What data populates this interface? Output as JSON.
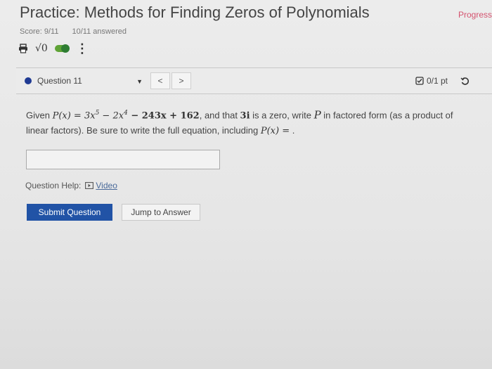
{
  "header": {
    "title": "Practice: Methods for Finding Zeros of Polynomials",
    "progress_label": "Progress",
    "score": "Score: 9/11",
    "answered": "10/11 answered"
  },
  "tools": {
    "print_icon": "printer-icon",
    "sqrt_label": "√0",
    "toggle_state": "on",
    "more_icon": "kebab-icon"
  },
  "question_bar": {
    "selected_question": "Question 11",
    "status_color": "#1f3a93",
    "prev_label": "<",
    "next_label": ">",
    "points": "0/1 pt"
  },
  "question": {
    "t1": "Given ",
    "m1": "P(x) = 3x",
    "e1": "5",
    "m2": " − 2x",
    "e2": "4",
    "m3": " − 243x + 162",
    "t2": ", and that ",
    "m4": "3i",
    "t3": " is a zero, write ",
    "m5": "P",
    "t4": " in factored form (as a product of linear factors). Be sure to write the full equation, including ",
    "m6": "P(x) =",
    "t5": " ."
  },
  "answer_field": {
    "value": ""
  },
  "help": {
    "label": "Question Help:",
    "video_label": "Video"
  },
  "actions": {
    "submit_label": "Submit Question",
    "jump_label": "Jump to Answer",
    "submit_color": "#2153a6"
  }
}
